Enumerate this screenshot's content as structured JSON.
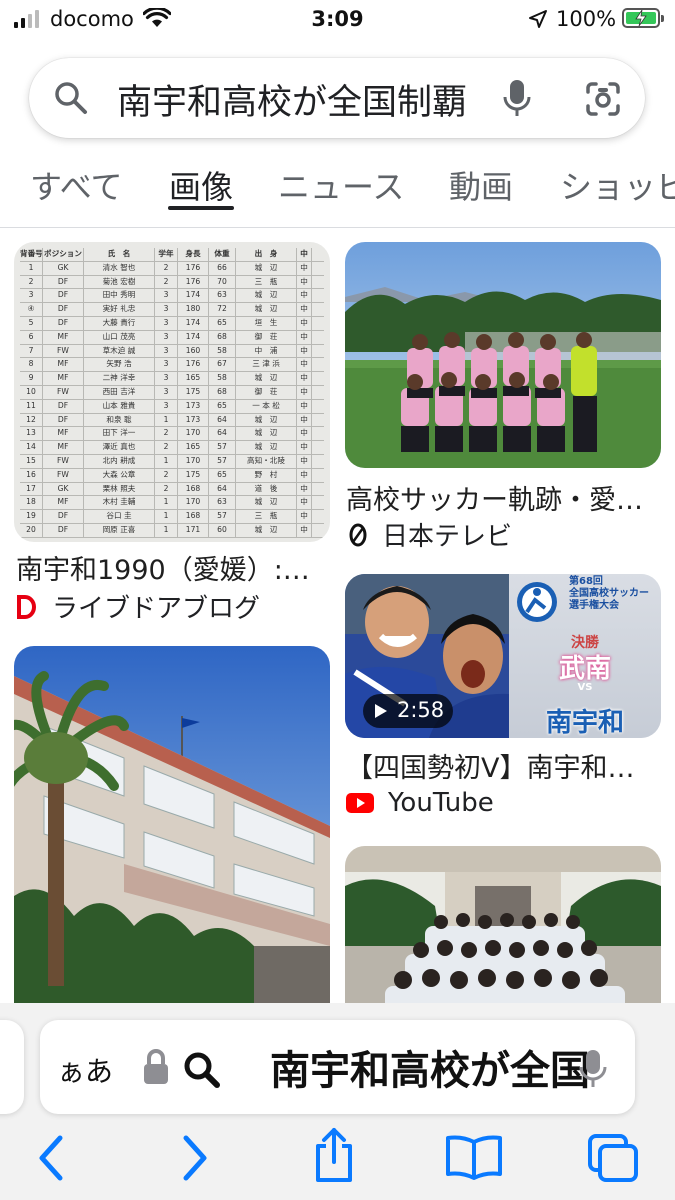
{
  "status_bar": {
    "carrier": "docomo",
    "time": "3:09",
    "battery": "100%"
  },
  "search": {
    "query": "南宇和高校が全国制覇"
  },
  "tabs": [
    {
      "label": "すべて"
    },
    {
      "label": "画像"
    },
    {
      "label": "ニュース"
    },
    {
      "label": "動画"
    },
    {
      "label": "ショッピ"
    }
  ],
  "results": [
    {
      "title": "南宇和1990（愛媛）:…",
      "source": "ライブドアブログ"
    },
    {
      "title": "高校サッカー軌跡・愛…",
      "source": "日本テレビ"
    },
    {
      "title": "【四国勢初V】南宇和…",
      "source": "YouTube",
      "duration": "2:58",
      "thumb_text": {
        "edition": "第68回",
        "tournament": "全国高校サッカー",
        "event": "選手権大会",
        "stage": "決勝",
        "team_a": "武南",
        "vs": "VS",
        "team_b": "南宇和"
      }
    }
  ],
  "roster": {
    "headers": [
      "背番号",
      "ポジション",
      "氏　名",
      "学年",
      "身長",
      "体重",
      "出　身",
      "中"
    ],
    "rows": [
      [
        "1",
        "GK",
        "清水 智也",
        "2",
        "176",
        "66",
        "城　辺",
        "中"
      ],
      [
        "2",
        "DF",
        "菊池 宏樹",
        "2",
        "176",
        "70",
        "三　瓶",
        "中"
      ],
      [
        "3",
        "DF",
        "田中 秀明",
        "3",
        "174",
        "63",
        "城　辺",
        "中"
      ],
      [
        "④",
        "DF",
        "実好 礼忠",
        "3",
        "180",
        "72",
        "城　辺",
        "中"
      ],
      [
        "5",
        "DF",
        "大藤 貴行",
        "3",
        "174",
        "65",
        "垣　生",
        "中"
      ],
      [
        "6",
        "MF",
        "山口 茂亮",
        "3",
        "174",
        "68",
        "御　荘",
        "中"
      ],
      [
        "7",
        "FW",
        "草木迫 誠",
        "3",
        "160",
        "58",
        "中　浦",
        "中"
      ],
      [
        "8",
        "MF",
        "矢野 浩",
        "3",
        "176",
        "67",
        "三 津 浜",
        "中"
      ],
      [
        "9",
        "MF",
        "二神 洋幸",
        "3",
        "165",
        "58",
        "城　辺",
        "中"
      ],
      [
        "10",
        "FW",
        "西田 吉洋",
        "3",
        "175",
        "68",
        "御　荘",
        "中"
      ],
      [
        "11",
        "DF",
        "山本 雅貴",
        "3",
        "173",
        "65",
        "一 本 松",
        "中"
      ],
      [
        "12",
        "DF",
        "和泉 聡",
        "1",
        "173",
        "64",
        "城　辺",
        "中"
      ],
      [
        "13",
        "MF",
        "田下 洋一",
        "2",
        "170",
        "64",
        "城　辺",
        "中"
      ],
      [
        "14",
        "MF",
        "澤近 真也",
        "2",
        "165",
        "57",
        "城　辺",
        "中"
      ],
      [
        "15",
        "FW",
        "北内 耕成",
        "1",
        "170",
        "57",
        "高知・北陵",
        "中"
      ],
      [
        "16",
        "FW",
        "大森 公章",
        "2",
        "175",
        "65",
        "野　村",
        "中"
      ],
      [
        "17",
        "GK",
        "栗林 照夫",
        "2",
        "168",
        "64",
        "道　後",
        "中"
      ],
      [
        "18",
        "MF",
        "木村 圭輔",
        "1",
        "170",
        "63",
        "城　辺",
        "中"
      ],
      [
        "19",
        "DF",
        "谷口 圭",
        "1",
        "168",
        "57",
        "三　瓶",
        "中"
      ],
      [
        "20",
        "DF",
        "岡原 正喜",
        "1",
        "171",
        "60",
        "城　辺",
        "中"
      ]
    ]
  },
  "browser": {
    "aa_label": "ぁあ",
    "url_text": "南宇和高校が全国制覇"
  },
  "colors": {
    "accent_blue": "#1a73e8",
    "safari_blue": "#0a7aff",
    "youtube_red": "#ff0000",
    "battery_green": "#34c759"
  }
}
